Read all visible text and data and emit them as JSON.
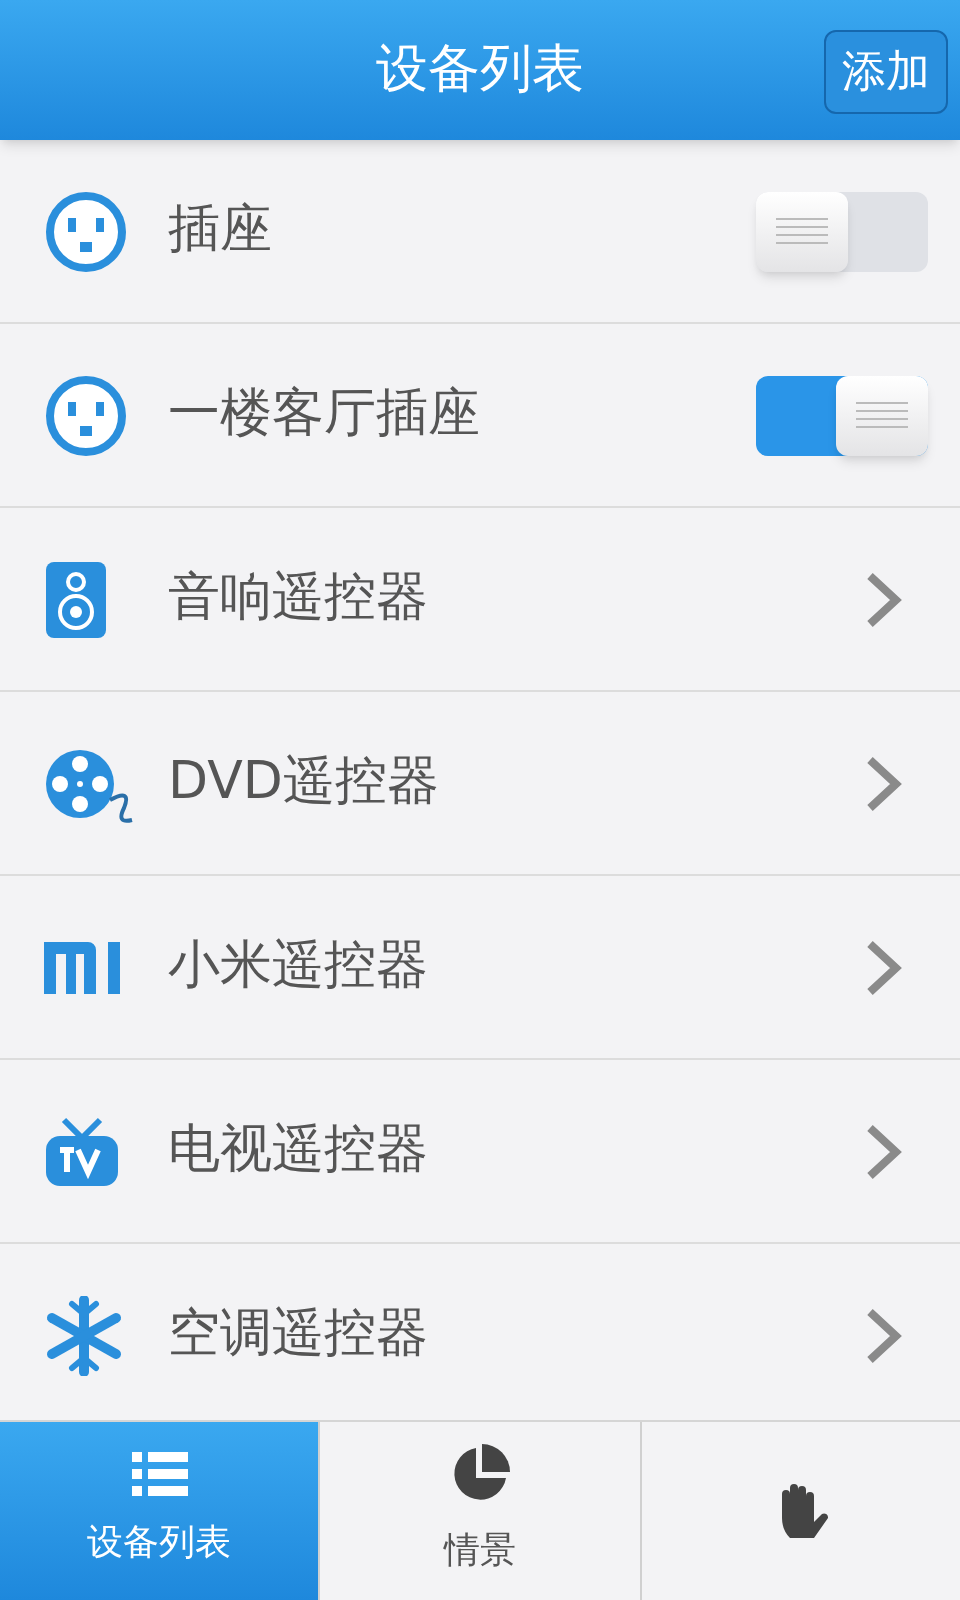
{
  "header": {
    "title": "设备列表",
    "add_button": "添加"
  },
  "devices": [
    {
      "kind": "toggle",
      "name": "插座",
      "on": false
    },
    {
      "kind": "toggle",
      "name": "一楼客厅插座",
      "on": true
    },
    {
      "kind": "link",
      "name": "音响遥控器"
    },
    {
      "kind": "link",
      "name": "DVD遥控器"
    },
    {
      "kind": "link",
      "name": "小米遥控器"
    },
    {
      "kind": "link",
      "name": "电视遥控器"
    },
    {
      "kind": "link",
      "name": "空调遥控器"
    }
  ],
  "tabs": [
    {
      "label": "设备列表",
      "selected": true
    },
    {
      "label": "情景",
      "selected": false
    },
    {
      "selected": false
    }
  ]
}
